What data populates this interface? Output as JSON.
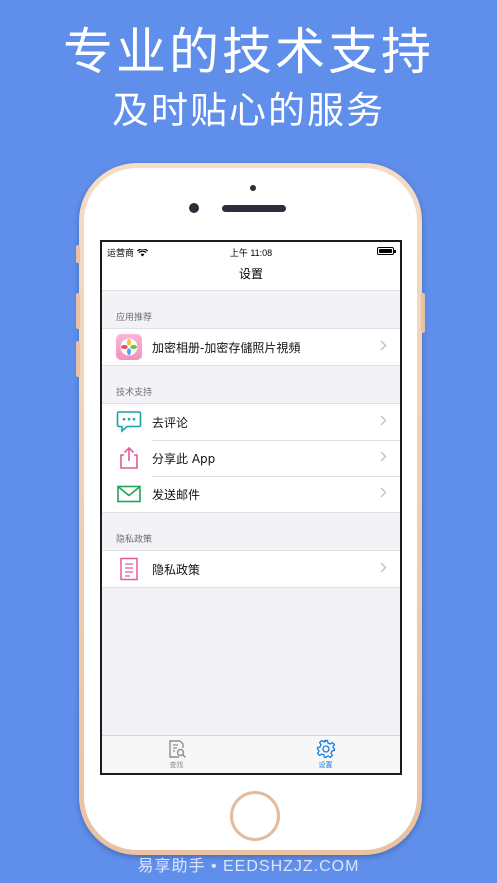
{
  "promo": {
    "headline": "专业的技术支持",
    "subheadline": "及时贴心的服务"
  },
  "statusbar": {
    "carrier": "运营商",
    "time": "上午 11:08"
  },
  "navbar": {
    "title": "设置"
  },
  "sections": [
    {
      "header": "应用推荐",
      "items": [
        {
          "label": "加密相册-加密存儲照片視頻",
          "icon": "photo-app-icon"
        }
      ]
    },
    {
      "header": "技术支持",
      "items": [
        {
          "label": "去评论",
          "icon": "chat-bubble-icon"
        },
        {
          "label": "分享此 App",
          "icon": "share-icon"
        },
        {
          "label": "发送邮件",
          "icon": "mail-icon"
        }
      ]
    },
    {
      "header": "隐私政策",
      "items": [
        {
          "label": "隐私政策",
          "icon": "document-icon"
        }
      ]
    }
  ],
  "tabbar": {
    "tabs": [
      {
        "label": "查找",
        "icon": "search-document-icon",
        "active": false
      },
      {
        "label": "设置",
        "icon": "gear-icon",
        "active": true
      }
    ]
  },
  "colors": {
    "background": "#5f8eeb",
    "accent": "#1a7de0",
    "icon_teal": "#17a0a6",
    "icon_pink": "#e05c9a",
    "icon_green": "#22a25a"
  },
  "watermark": "易享助手 • EEDSHZJZ.COM"
}
